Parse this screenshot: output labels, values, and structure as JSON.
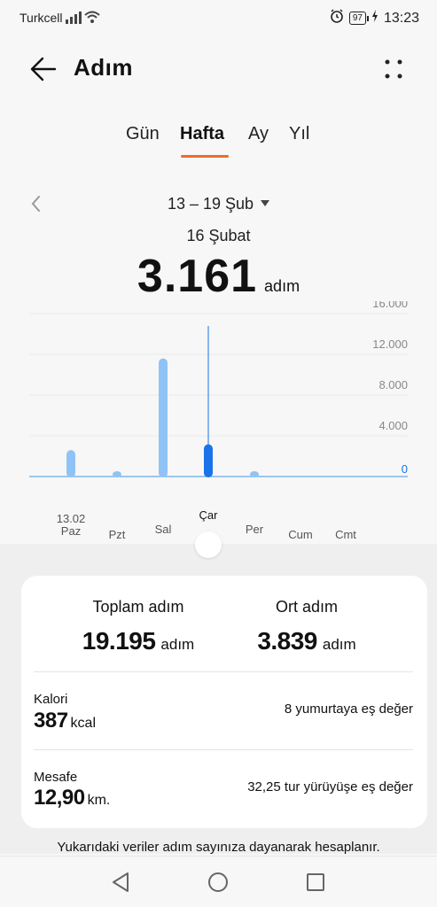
{
  "status_bar": {
    "carrier": "Turkcell",
    "battery": "97",
    "time": "13:23",
    "icons": [
      "signal-icon",
      "wifi-icon",
      "alarm-icon",
      "battery-icon",
      "charging-icon"
    ]
  },
  "header": {
    "title": "Adım",
    "back_icon": "arrow-left-icon",
    "menu_icon": "more-dots-icon"
  },
  "tabs": [
    {
      "label": "Gün",
      "active": false
    },
    {
      "label": "Hafta",
      "active": true
    },
    {
      "label": "Ay",
      "active": false
    },
    {
      "label": "Yıl",
      "active": false
    }
  ],
  "accent_color": "#f06b2c",
  "range": {
    "label": "13 – 19 Şub",
    "selected_day": "16 Şubat",
    "value": "3.161",
    "unit": "adım"
  },
  "chart_data": {
    "type": "bar",
    "categories": [
      "Paz",
      "Pzt",
      "Sal",
      "Çar",
      "Per",
      "Cum",
      "Cmt"
    ],
    "date_label": "13.02",
    "values": [
      2600,
      500,
      11600,
      3161,
      300,
      0,
      0
    ],
    "selected_index": 3,
    "ylim": [
      0,
      16000
    ],
    "yticks": [
      "0",
      "4.000",
      "8.000",
      "12.000",
      "16.000"
    ],
    "ytick_values": [
      0,
      4000,
      8000,
      12000,
      16000
    ],
    "bar_color": "#90c3f5",
    "selected_color": "#1a73e8",
    "grid": true
  },
  "summary": {
    "total_label": "Toplam adım",
    "total_value": "19.195",
    "total_unit": "adım",
    "avg_label": "Ort adım",
    "avg_value": "3.839",
    "avg_unit": "adım"
  },
  "calories": {
    "label": "Kalori",
    "value": "387",
    "unit": "kcal",
    "note": "8 yumurtaya eş değer"
  },
  "distance": {
    "label": "Mesafe",
    "value": "12,90",
    "unit": "km.",
    "note": "32,25 tur yürüyüşe eş değer"
  },
  "footnote": "Yukarıdaki veriler adım sayınıza dayanarak hesaplanır.",
  "nav": [
    "back-triangle-icon",
    "home-circle-icon",
    "recents-square-icon"
  ]
}
